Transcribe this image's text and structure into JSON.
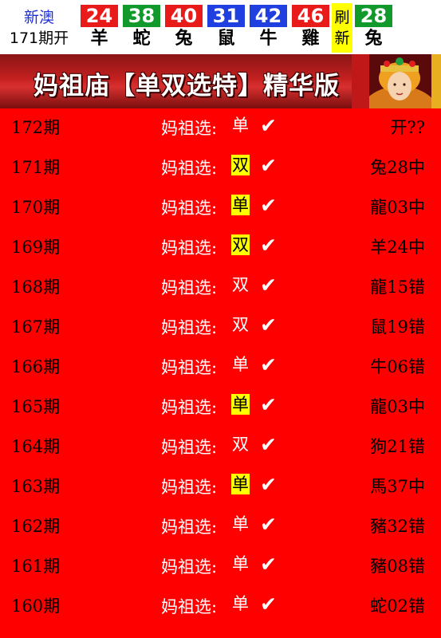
{
  "header": {
    "lottery_name": "新澳",
    "period_label": "171期开",
    "balls": [
      {
        "number": "24",
        "zodiac": "羊",
        "color": "red"
      },
      {
        "number": "38",
        "zodiac": "蛇",
        "color": "green"
      },
      {
        "number": "40",
        "zodiac": "兔",
        "color": "red"
      },
      {
        "number": "31",
        "zodiac": "鼠",
        "color": "blue"
      },
      {
        "number": "42",
        "zodiac": "牛",
        "color": "blue"
      },
      {
        "number": "46",
        "zodiac": "雞",
        "color": "red"
      }
    ],
    "refresh_label_1": "刷",
    "refresh_label_2": "新",
    "special_ball": {
      "number": "28",
      "zodiac": "兔",
      "color": "green"
    }
  },
  "banner": {
    "title": "妈祖庙【单双选特】精华版"
  },
  "colors": {
    "background": "#ff0000",
    "highlight": "#ffff00",
    "ball_red": "#e81a1a",
    "ball_green": "#119a2b",
    "ball_blue": "#1f3fe0"
  },
  "pick_label": "妈祖选:",
  "check_mark": "✔",
  "rows": [
    {
      "period": "172期",
      "choice": "单",
      "highlight": false,
      "result": "开??"
    },
    {
      "period": "171期",
      "choice": "双",
      "highlight": true,
      "result": "兔28中"
    },
    {
      "period": "170期",
      "choice": "单",
      "highlight": true,
      "result": "龍03中"
    },
    {
      "period": "169期",
      "choice": "双",
      "highlight": true,
      "result": "羊24中"
    },
    {
      "period": "168期",
      "choice": "双",
      "highlight": false,
      "result": "龍15错"
    },
    {
      "period": "167期",
      "choice": "双",
      "highlight": false,
      "result": "鼠19错"
    },
    {
      "period": "166期",
      "choice": "单",
      "highlight": false,
      "result": "牛06错"
    },
    {
      "period": "165期",
      "choice": "单",
      "highlight": true,
      "result": "龍03中"
    },
    {
      "period": "164期",
      "choice": "双",
      "highlight": false,
      "result": "狗21错"
    },
    {
      "period": "163期",
      "choice": "单",
      "highlight": true,
      "result": "馬37中"
    },
    {
      "period": "162期",
      "choice": "单",
      "highlight": false,
      "result": "豬32错"
    },
    {
      "period": "161期",
      "choice": "单",
      "highlight": false,
      "result": "豬08错"
    },
    {
      "period": "160期",
      "choice": "单",
      "highlight": false,
      "result": "蛇02错"
    }
  ]
}
